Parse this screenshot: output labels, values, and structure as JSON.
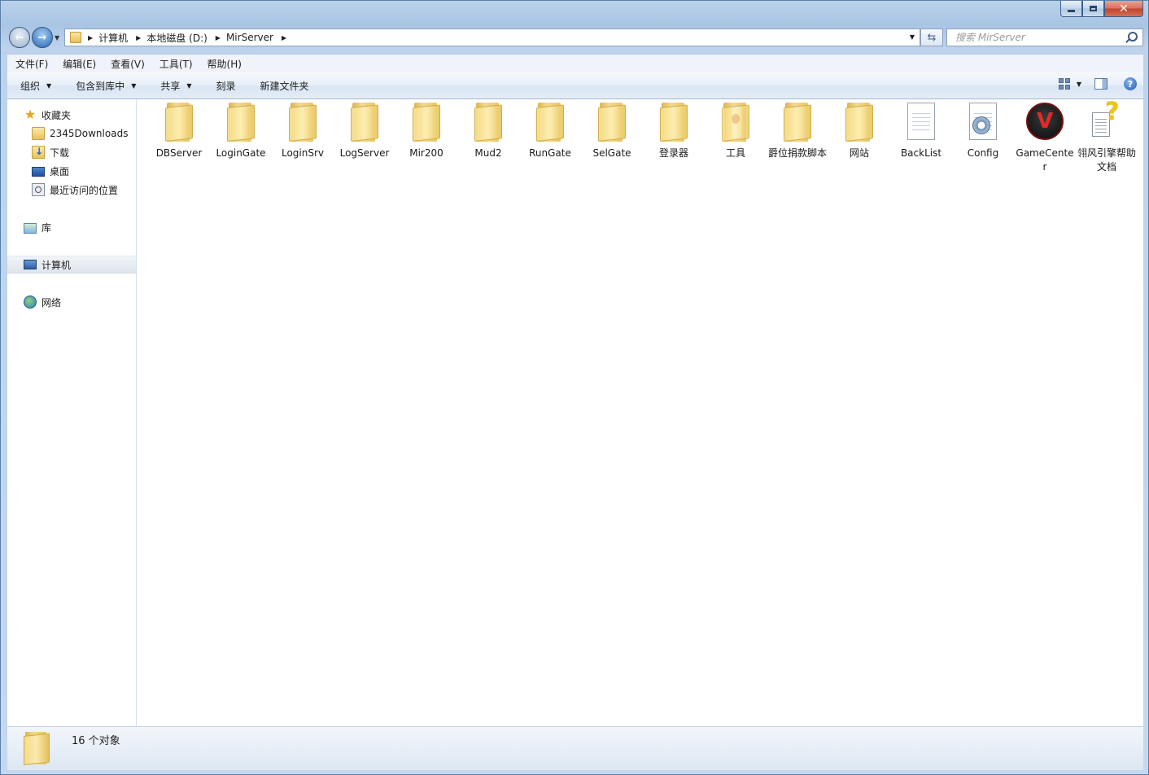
{
  "address": {
    "crumbs": [
      "计算机",
      "本地磁盘 (D:)",
      "MirServer"
    ]
  },
  "search": {
    "placeholder": "搜索 MirServer"
  },
  "menubar": [
    "文件(F)",
    "编辑(E)",
    "查看(V)",
    "工具(T)",
    "帮助(H)"
  ],
  "toolbar": {
    "organize": "组织",
    "include_library": "包含到库中",
    "share": "共享",
    "burn": "刻录",
    "new_folder": "新建文件夹"
  },
  "navpane": {
    "favorites": "收藏夹",
    "fav_items": [
      "2345Downloads",
      "下载",
      "桌面",
      "最近访问的位置"
    ],
    "libraries": "库",
    "computer": "计算机",
    "network": "网络"
  },
  "files": [
    {
      "name": "DBServer",
      "type": "folder"
    },
    {
      "name": "LoginGate",
      "type": "folder"
    },
    {
      "name": "LoginSrv",
      "type": "folder"
    },
    {
      "name": "LogServer",
      "type": "folder"
    },
    {
      "name": "Mir200",
      "type": "folder"
    },
    {
      "name": "Mud2",
      "type": "folder"
    },
    {
      "name": "RunGate",
      "type": "folder"
    },
    {
      "name": "SelGate",
      "type": "folder"
    },
    {
      "name": "登录器",
      "type": "folder"
    },
    {
      "name": "工具",
      "type": "folder-marked"
    },
    {
      "name": "爵位捐款脚本",
      "type": "folder"
    },
    {
      "name": "网站",
      "type": "folder"
    },
    {
      "name": "BackList",
      "type": "text-file"
    },
    {
      "name": "Config",
      "type": "config-file"
    },
    {
      "name": "GameCenter",
      "type": "app"
    },
    {
      "name": "翎风引擎帮助文档",
      "type": "help-file"
    }
  ],
  "status": {
    "count_text": "16 个对象"
  },
  "colors": {
    "accent": "#2a66b4",
    "selection": "#dfe5ec"
  }
}
